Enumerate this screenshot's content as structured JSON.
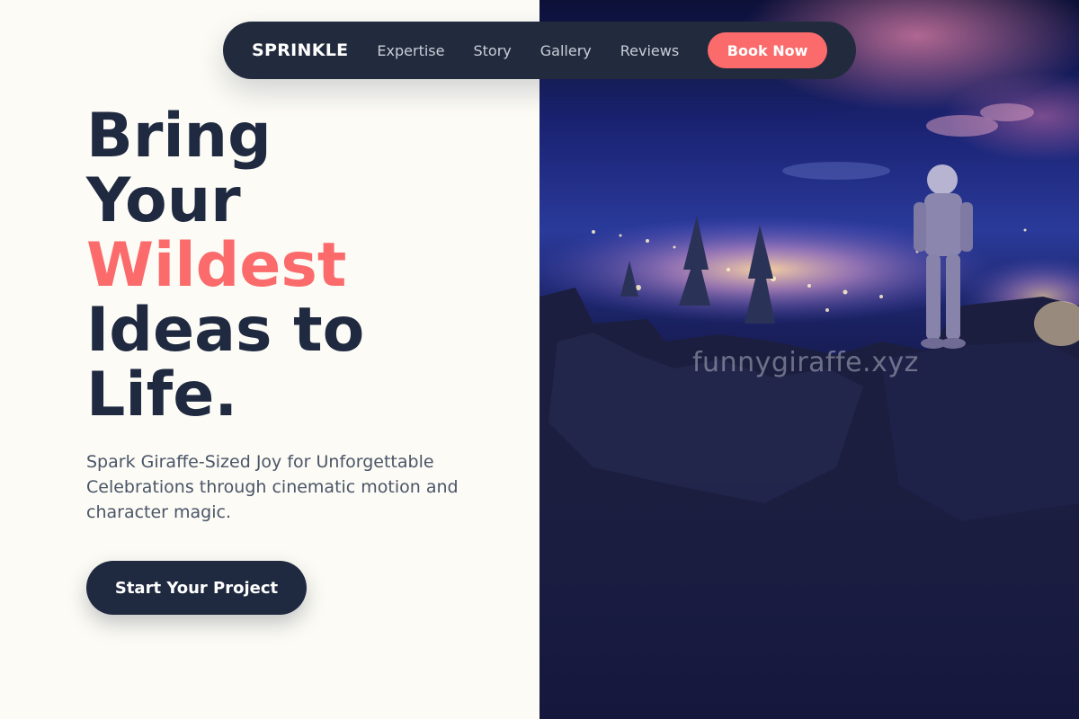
{
  "nav": {
    "brand": "SPRINKLE",
    "links": [
      "Expertise",
      "Story",
      "Gallery",
      "Reviews"
    ],
    "book_label": "Book Now"
  },
  "hero": {
    "line1": "Bring",
    "line2": "Your",
    "accent": "Wildest",
    "line4": "Ideas to",
    "line5": "Life.",
    "subtitle": "Spark Giraffe-Sized Joy for Unforgettable Celebrations through cinematic motion and character magic.",
    "cta_label": "Start Your Project"
  },
  "image": {
    "watermark": "funnygiraffe.xyz",
    "description_icon": "astronaut-on-cliff-image"
  },
  "colors": {
    "accent": "#fb6b6b",
    "navy": "#1f2940",
    "background": "#fcfbf5"
  }
}
